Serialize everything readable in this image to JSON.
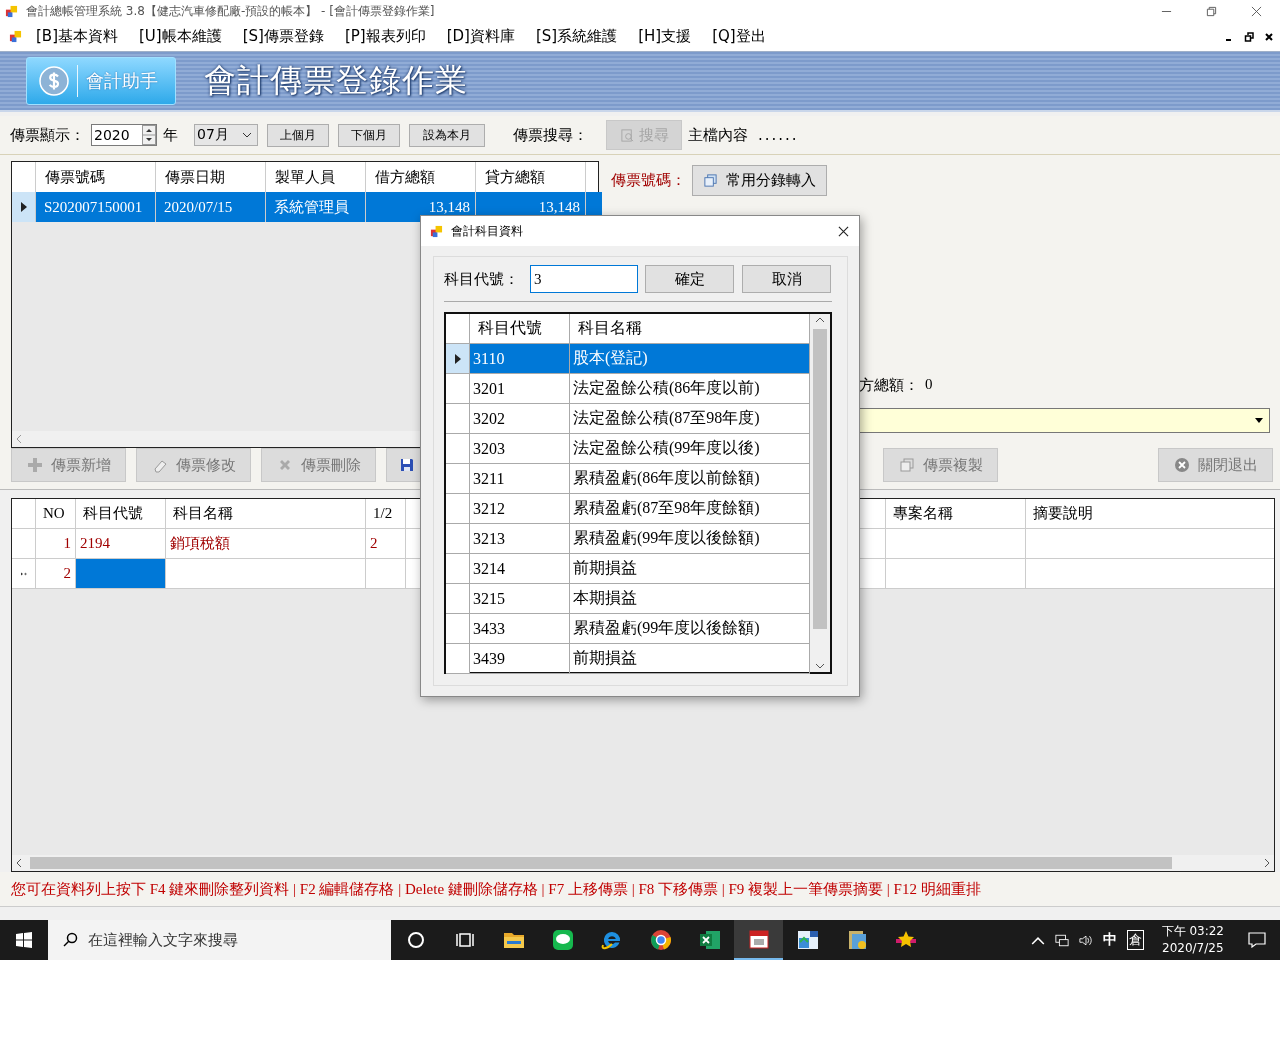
{
  "window": {
    "title": "會計總帳管理系統 3.8【健志汽車修配廠-預設的帳本】 - [會計傳票登錄作業]"
  },
  "menu": [
    "[B]基本資料",
    "[U]帳本維護",
    "[S]傳票登錄",
    "[P]報表列印",
    "[D]資料庫",
    "[S]系統維護",
    "[H]支援",
    "[Q]登出"
  ],
  "header": {
    "helper_button": "會計助手",
    "title": "會計傳票登錄作業"
  },
  "toolbar": {
    "display_label": "傳票顯示：",
    "year": "2020",
    "year_unit": "年",
    "month": "07月",
    "prev_month": "上個月",
    "next_month": "下個月",
    "this_month": "設為本月",
    "search_label": "傳票搜尋：",
    "search_button": "搜尋",
    "search_disabled": true,
    "master_label": "主檔內容",
    "master_value": "......"
  },
  "voucher_table": {
    "columns": [
      "傳票號碼",
      "傳票日期",
      "製單人員",
      "借方總額",
      "貸方總額"
    ],
    "rows": [
      {
        "cells": [
          "S202007150001",
          "2020/07/15",
          "系統管理員",
          "13,148",
          "13,148"
        ],
        "selected": true
      }
    ]
  },
  "detail_panel": {
    "voucher_no_label": "傳票號碼：",
    "import_button": "常用分錄轉入",
    "total_label": "方總額：",
    "total_value": "0"
  },
  "actions": [
    {
      "kind": "add",
      "label": "傳票新增",
      "disabled": true
    },
    {
      "kind": "edit",
      "label": "傳票修改",
      "disabled": true
    },
    {
      "kind": "delete",
      "label": "傳票刪除",
      "disabled": true
    },
    {
      "kind": "save"
    },
    {
      "kind": "copy",
      "label": "傳票複製",
      "disabled": true
    },
    {
      "kind": "exit",
      "label": "關閉退出",
      "disabled": true
    }
  ],
  "detail_table": {
    "columns": [
      "NO",
      "科目代號",
      "科目名稱",
      "1/2",
      "專案名稱",
      "摘要說明"
    ],
    "rows": [
      {
        "no": "1",
        "code": "2194",
        "name": "銷項稅額",
        "side": "2",
        "new": false
      },
      {
        "no": "2",
        "new": true
      }
    ]
  },
  "hint": "您可在資料列上按下 F4 鍵來刪除整列資料 | F2 編輯儲存格 | Delete 鍵刪除儲存格 | F7 上移傳票  | F8 下移傳票 | F9 複製上一筆傳票摘要 | F12 明細重排",
  "dialog": {
    "title": "會計科目資料",
    "code_label": "科目代號：",
    "code_value": "3",
    "ok": "確定",
    "cancel": "取消",
    "columns": [
      "科目代號",
      "科目名稱"
    ],
    "rows": [
      {
        "code": "3110",
        "name": "股本(登記)",
        "selected": true
      },
      {
        "code": "3201",
        "name": "法定盈餘公積(86年度以前)",
        "selected": false
      },
      {
        "code": "3202",
        "name": "法定盈餘公積(87至98年度)",
        "selected": false
      },
      {
        "code": "3203",
        "name": "法定盈餘公積(99年度以後)",
        "selected": false
      },
      {
        "code": "3211",
        "name": "累積盈虧(86年度以前餘額)",
        "selected": false
      },
      {
        "code": "3212",
        "name": "累積盈虧(87至98年度餘額)",
        "selected": false
      },
      {
        "code": "3213",
        "name": "累積盈虧(99年度以後餘額)",
        "selected": false
      },
      {
        "code": "3214",
        "name": "前期損益",
        "selected": false
      },
      {
        "code": "3215",
        "name": "本期損益",
        "selected": false
      },
      {
        "code": "3433",
        "name": "累積盈虧(99年度以後餘額)",
        "selected": false
      },
      {
        "code": "3439",
        "name": "前期損益",
        "selected": false
      }
    ]
  },
  "taskbar": {
    "search_placeholder": "在這裡輸入文字來搜尋",
    "apps": [
      {
        "kind": "circle",
        "selected": false
      },
      {
        "kind": "taskview",
        "selected": false
      },
      {
        "kind": "folder",
        "selected": false
      },
      {
        "kind": "chat",
        "selected": false
      },
      {
        "kind": "browser",
        "selected": false
      },
      {
        "kind": "globe",
        "selected": false
      },
      {
        "kind": "sheet",
        "selected": false
      },
      {
        "kind": "calendar",
        "selected": true
      },
      {
        "kind": "window",
        "selected": false
      },
      {
        "kind": "files",
        "selected": false
      },
      {
        "kind": "star",
        "selected": false
      }
    ],
    "ime": "中",
    "ime_mode": "倉",
    "time": "下午 03:22",
    "date": "2020/7/25"
  }
}
